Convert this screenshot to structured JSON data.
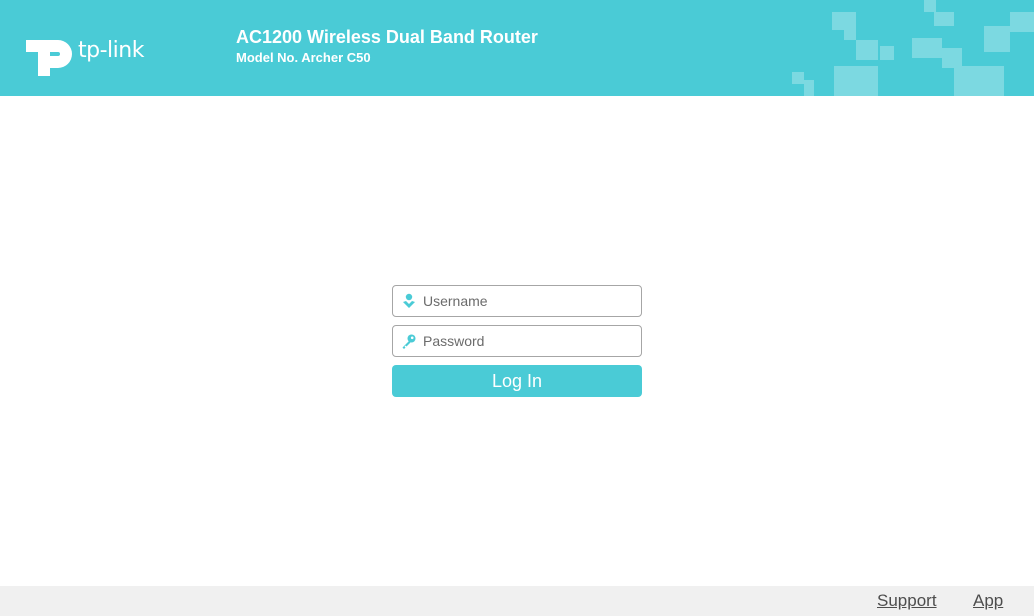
{
  "header": {
    "brand": "tp-link",
    "product_name": "AC1200 Wireless Dual Band Router",
    "model": "Model No. Archer C50"
  },
  "login": {
    "username_placeholder": "Username",
    "password_placeholder": "Password",
    "login_label": "Log In"
  },
  "footer": {
    "support_label": "Support",
    "app_label": "App"
  },
  "colors": {
    "accent": "#4acbd6",
    "footer_bg": "#f0f0f0",
    "icon": "#4acbd6"
  }
}
